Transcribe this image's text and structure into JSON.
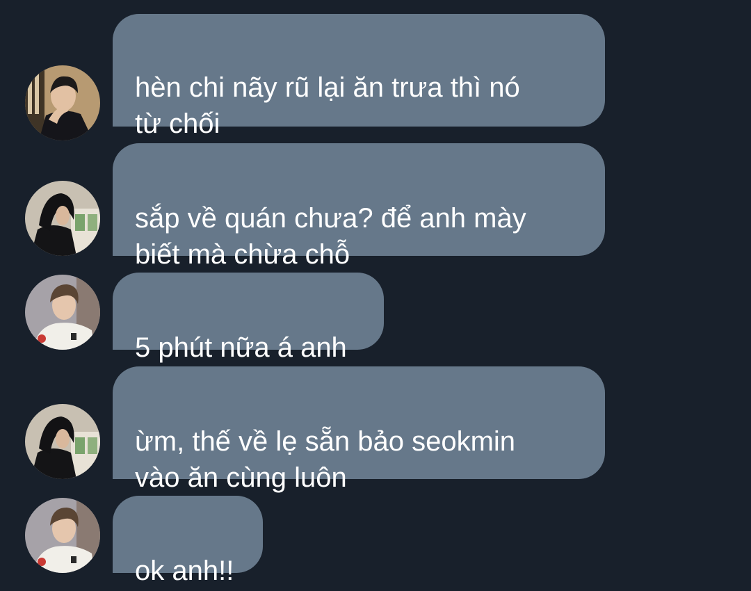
{
  "conversation": {
    "messages": [
      {
        "sender": "hair-forward-man",
        "text": "hèn chi nãy rũ lại ăn trưa thì nó\ntừ chối"
      },
      {
        "sender": "long-hair-man",
        "text": "sắp về quán chưa? để anh mày\nbiết mà chừa chỗ"
      },
      {
        "sender": "white-shirt-man",
        "text": "5 phút nữa á anh"
      },
      {
        "sender": "long-hair-man",
        "text": "ừm, thế về lẹ sẵn bảo seokmin\nvào ăn cùng luôn"
      },
      {
        "sender": "white-shirt-man",
        "text": "ok anh!!"
      }
    ]
  },
  "colors": {
    "background": "#18202b",
    "bubble": "#66788a",
    "text": "#ffffff"
  }
}
